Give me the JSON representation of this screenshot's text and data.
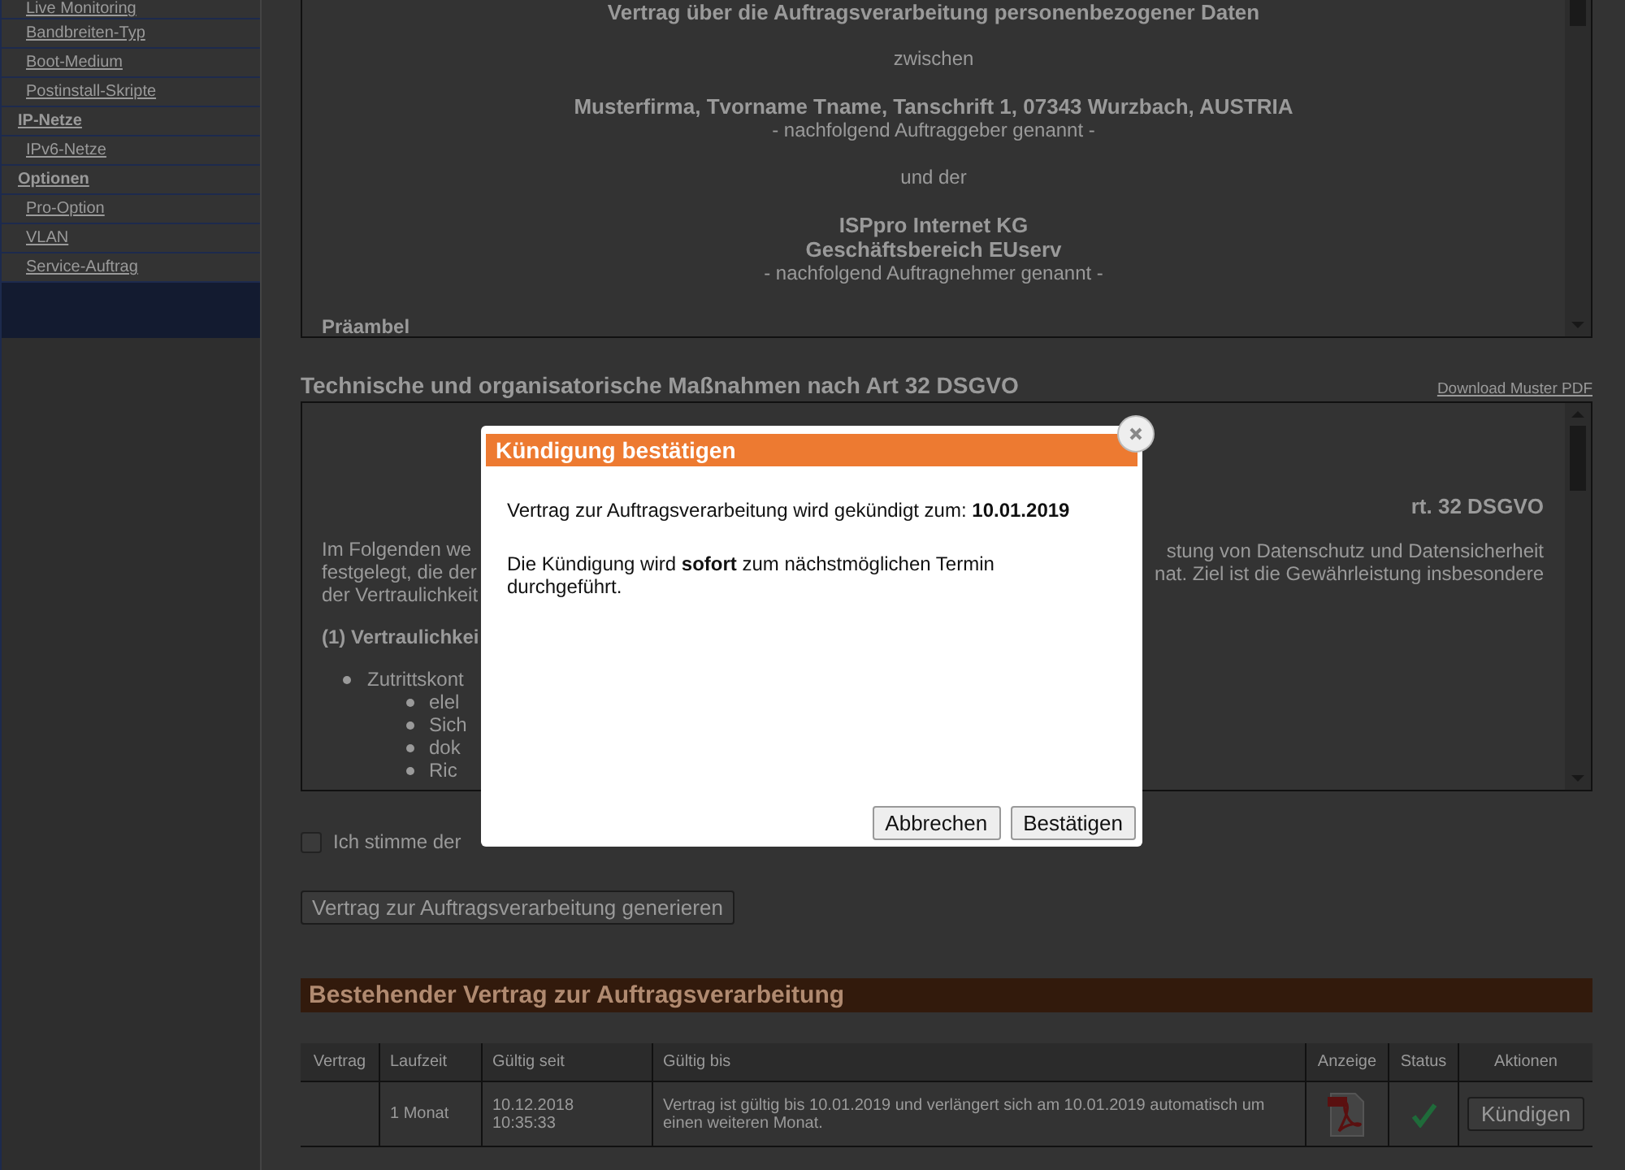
{
  "sidebar": {
    "items": [
      {
        "label": "Live Monitoring",
        "kind": "link"
      },
      {
        "label": "Bandbreiten-Typ",
        "kind": "link"
      },
      {
        "label": "Boot-Medium",
        "kind": "link"
      },
      {
        "label": "Postinstall-Skripte",
        "kind": "link"
      },
      {
        "label": "IP-Netze",
        "kind": "section"
      },
      {
        "label": "IPv6-Netze",
        "kind": "link"
      },
      {
        "label": "Optionen",
        "kind": "section"
      },
      {
        "label": "Pro-Option",
        "kind": "link"
      },
      {
        "label": "VLAN",
        "kind": "link"
      },
      {
        "label": "Service-Auftrag",
        "kind": "link"
      }
    ]
  },
  "contract_box": {
    "lines": [
      {
        "text": "Vertrag über die Auftragsverarbeitung personenbezogener Daten",
        "kind": "title"
      },
      {
        "text": "zwischen",
        "kind": "gap"
      },
      {
        "text": "Musterfirma, Tvorname Tname, Tanschrift 1, 07343 Wurzbach, AUSTRIA",
        "kind": "bold"
      },
      {
        "text": "- nachfolgend Auftraggeber genannt -",
        "kind": "plain"
      },
      {
        "text": "und der",
        "kind": "gap"
      },
      {
        "text": "ISPpro Internet KG",
        "kind": "bold"
      },
      {
        "text": "Geschäftsbereich EUserv",
        "kind": "bold"
      },
      {
        "text": "- nachfolgend Auftragnehmer genannt -",
        "kind": "plain"
      },
      {
        "text": "Präambel",
        "kind": "heading"
      }
    ]
  },
  "measures": {
    "title": "Technische und organisatorische Maßnahmen nach Art 32 DSGVO",
    "download_link": "Download Muster PDF",
    "left_fragments": [
      {
        "text": "Im Folgenden we",
        "kind": "para"
      },
      {
        "text": "festgelegt, die der",
        "kind": "para"
      },
      {
        "text": "der Vertraulichkeit",
        "kind": "para"
      },
      {
        "text": "(1) Vertraulichkei",
        "kind": "heading"
      },
      {
        "text": "Zutrittskont",
        "kind": "bullet"
      },
      {
        "text": "elel",
        "kind": "subbullet"
      },
      {
        "text": "Sich",
        "kind": "subbullet"
      },
      {
        "text": "dok",
        "kind": "subbullet"
      },
      {
        "text": "Ric",
        "kind": "subbullet"
      }
    ],
    "right_fragments": [
      {
        "text": "rt. 32 DSGVO",
        "kind": "heading"
      },
      {
        "text": "stung von Datenschutz und Datensicherheit",
        "kind": "para"
      },
      {
        "text": "nat. Ziel ist die Gewährleistung insbesondere",
        "kind": "para"
      }
    ]
  },
  "agree": {
    "label": "Ich stimme der",
    "checked": false
  },
  "generate_button": "Vertrag zur Auftragsverarbeitung generieren",
  "existing": {
    "title": "Bestehender Vertrag zur Auftragsverarbeitung",
    "columns": [
      "Vertrag",
      "Laufzeit",
      "Gültig seit",
      "Gültig bis",
      "Anzeige",
      "Status",
      "Aktionen"
    ],
    "rows": [
      {
        "vertrag": "",
        "laufzeit": "1 Monat",
        "seit": "10.12.2018\n10:35:33",
        "bis": "Vertrag ist gültig bis 10.01.2019 und verlängert sich am 10.01.2019 automatisch um einen weiteren Monat.",
        "active": true,
        "action": "Kündigen"
      }
    ]
  },
  "dialog": {
    "title": "Kündigung bestätigen",
    "paragraphs": [
      "Vertrag zur Auftragsverarbeitung wird gekündigt zum: **10.01.2019**",
      "Die Kündigung wird **sofort** zum nächstmöglichen Termin durchgeführt."
    ],
    "buttons": [
      "Abbrechen",
      "Bestätigen"
    ]
  }
}
